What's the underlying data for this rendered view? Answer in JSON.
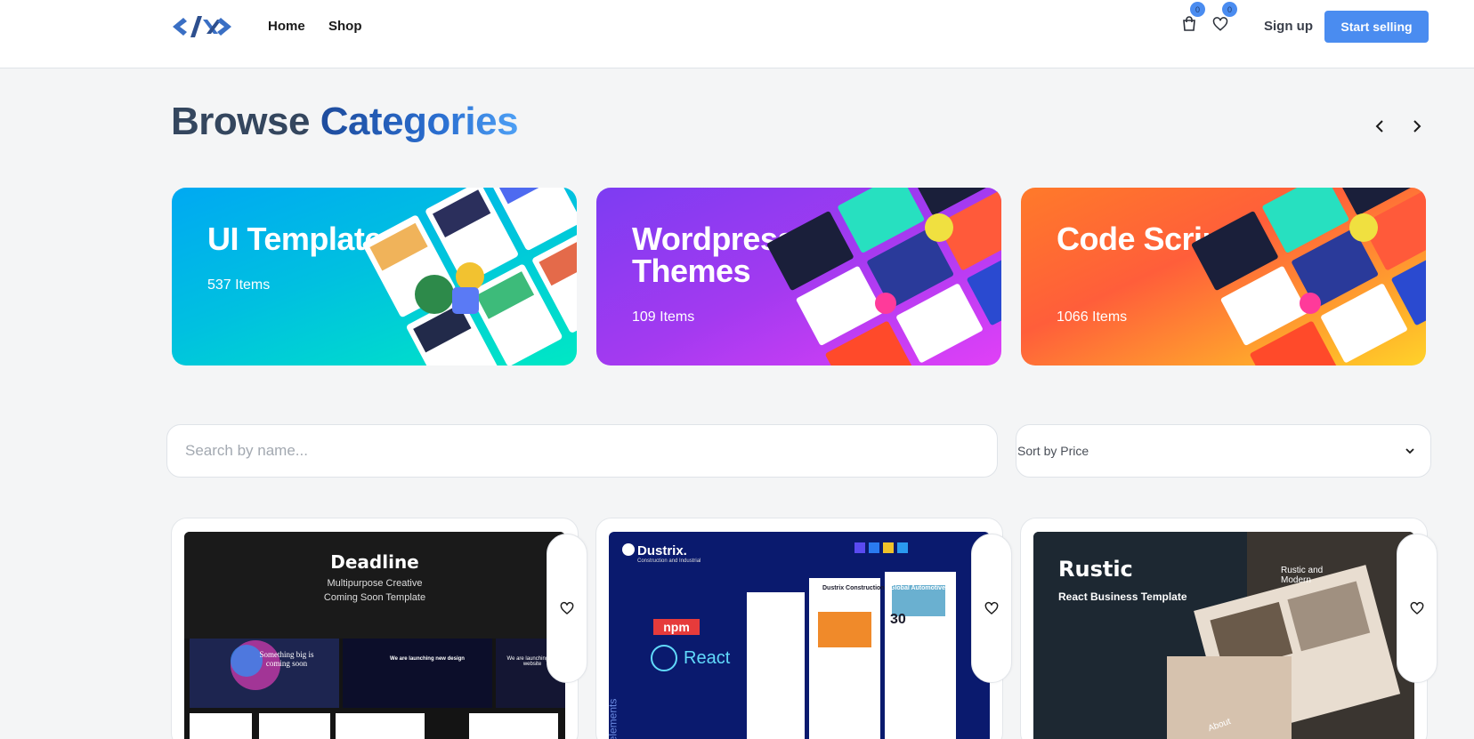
{
  "header": {
    "nav": [
      "Home",
      "Shop"
    ],
    "cart_count": "0",
    "wishlist_count": "0",
    "signup_label": "Sign up",
    "cta_label": "Start selling",
    "accent": "#4a8cf0"
  },
  "browse": {
    "title_part1": "Browse",
    "title_part2": "Categories"
  },
  "categories": [
    {
      "title": "UI Templates",
      "count": "537 Items"
    },
    {
      "title": "Wordpress Themes",
      "count": "109 Items"
    },
    {
      "title": "Code Scripts",
      "count": "1066 Items"
    }
  ],
  "filters": {
    "search_placeholder": "Search by name...",
    "sort_label": "Sort by Price"
  },
  "products": [
    {
      "name": "Deadline",
      "subtitle_line1": "Multipurpose Creative",
      "subtitle_line2": "Coming Soon Template",
      "mock_text_1": "Something big is coming soon",
      "mock_text_2": "We are launching new design",
      "mock_text_3": "We are launching our website"
    },
    {
      "brand": "Dustrix.",
      "brand_sub": "Construction and Industrial",
      "badge_npm": "npm",
      "badge_react": "React",
      "side_text": "elements",
      "mock_title": "Dustrix Construction",
      "mock_title_2": "Global Automotive",
      "mock_number": "30"
    },
    {
      "name": "Rustic",
      "subtitle": "React Business Template",
      "mock_text": "Rustic and Modern",
      "mock_text_2": "About"
    }
  ]
}
